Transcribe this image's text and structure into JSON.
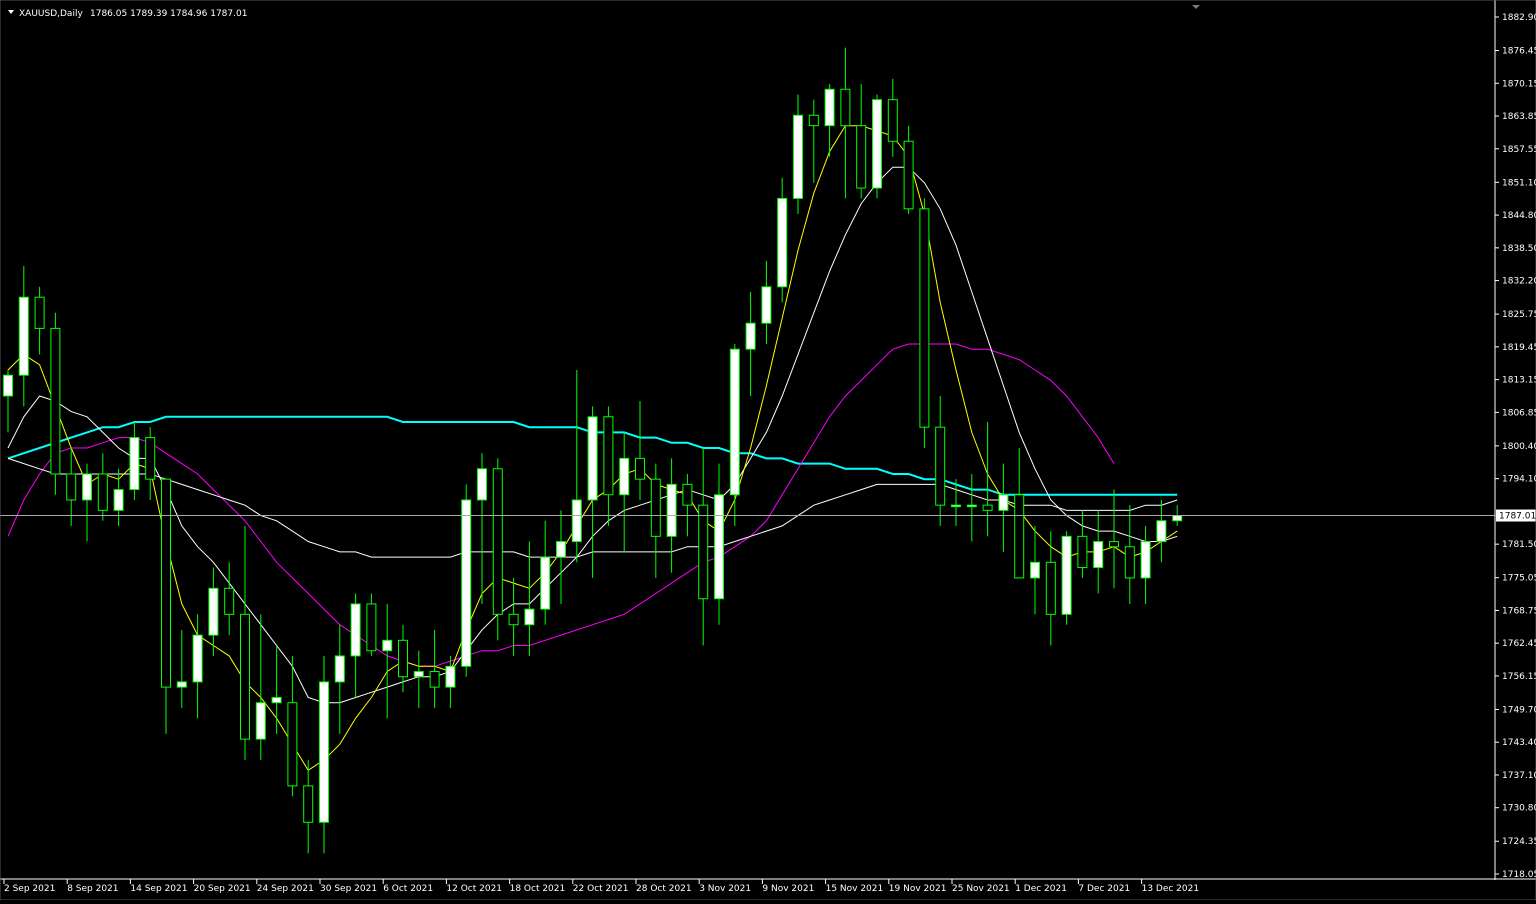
{
  "header": {
    "symbol": "XAUUSD,Daily",
    "ohlc": "1786.05 1789.39 1784.96 1787.01"
  },
  "colors": {
    "background": "#000000",
    "grid_line": "#ffffff",
    "bull_wick": "#00ff00",
    "bull_body": "#ffffff",
    "bear_wick": "#00ff00",
    "bear_body": "#000000",
    "ma_fast": "#ffff00",
    "ma_mid": "#ffffff",
    "ma_slow": "#ffffff",
    "ma_magenta": "#ff00ff",
    "ma_cyan": "#00ffff",
    "price_line": "#a9a9a9",
    "axis_text": "#ffffff"
  },
  "chart_data": {
    "type": "candlestick",
    "title": "XAUUSD,Daily",
    "ylim": [
      1718.05,
      1885.0
    ],
    "current_price": "1787.01",
    "y_ticks": [
      "1882.90",
      "1876.45",
      "1870.15",
      "1863.85",
      "1857.55",
      "1851.10",
      "1844.80",
      "1838.50",
      "1832.20",
      "1825.75",
      "1819.45",
      "1813.15",
      "1806.85",
      "1800.40",
      "1794.10",
      "1781.50",
      "1775.05",
      "1768.75",
      "1762.45",
      "1756.15",
      "1749.70",
      "1743.40",
      "1737.10",
      "1730.80",
      "1724.35",
      "1718.05"
    ],
    "x_ticks": [
      {
        "label": "2 Sep 2021",
        "index": 0
      },
      {
        "label": "8 Sep 2021",
        "index": 4
      },
      {
        "label": "14 Sep 2021",
        "index": 8
      },
      {
        "label": "20 Sep 2021",
        "index": 12
      },
      {
        "label": "24 Sep 2021",
        "index": 16
      },
      {
        "label": "30 Sep 2021",
        "index": 20
      },
      {
        "label": "6 Oct 2021",
        "index": 24
      },
      {
        "label": "12 Oct 2021",
        "index": 28
      },
      {
        "label": "18 Oct 2021",
        "index": 32
      },
      {
        "label": "22 Oct 2021",
        "index": 36
      },
      {
        "label": "28 Oct 2021",
        "index": 40
      },
      {
        "label": "3 Nov 2021",
        "index": 44
      },
      {
        "label": "9 Nov 2021",
        "index": 48
      },
      {
        "label": "15 Nov 2021",
        "index": 52
      },
      {
        "label": "19 Nov 2021",
        "index": 56
      },
      {
        "label": "25 Nov 2021",
        "index": 60
      },
      {
        "label": "1 Dec 2021",
        "index": 64
      },
      {
        "label": "7 Dec 2021",
        "index": 68
      },
      {
        "label": "13 Dec 2021",
        "index": 72
      }
    ],
    "candles": [
      [
        1810,
        1815,
        1803,
        1814
      ],
      [
        1814,
        1835,
        1808,
        1829
      ],
      [
        1829,
        1831,
        1818,
        1823
      ],
      [
        1823,
        1826,
        1791,
        1795
      ],
      [
        1795,
        1800,
        1785,
        1790
      ],
      [
        1790,
        1797,
        1782,
        1795
      ],
      [
        1795,
        1799,
        1786,
        1788
      ],
      [
        1788,
        1796,
        1785,
        1792
      ],
      [
        1792,
        1805,
        1790,
        1802
      ],
      [
        1802,
        1804,
        1790,
        1794
      ],
      [
        1794,
        1794,
        1745,
        1754
      ],
      [
        1754,
        1765,
        1750,
        1755
      ],
      [
        1755,
        1768,
        1748,
        1764
      ],
      [
        1764,
        1777,
        1760,
        1773
      ],
      [
        1773,
        1778,
        1764,
        1768
      ],
      [
        1768,
        1785,
        1740,
        1744
      ],
      [
        1744,
        1768,
        1740,
        1751
      ],
      [
        1751,
        1762,
        1745,
        1752
      ],
      [
        1751,
        1760,
        1733,
        1735
      ],
      [
        1735,
        1740,
        1722,
        1728
      ],
      [
        1728,
        1760,
        1722,
        1755
      ],
      [
        1755,
        1766,
        1745,
        1760
      ],
      [
        1760,
        1772,
        1752,
        1770
      ],
      [
        1770,
        1772,
        1760,
        1761
      ],
      [
        1761,
        1770,
        1748,
        1763
      ],
      [
        1763,
        1766,
        1753,
        1756
      ],
      [
        1756,
        1761,
        1750,
        1757
      ],
      [
        1757,
        1765,
        1750,
        1754
      ],
      [
        1754,
        1760,
        1750,
        1758
      ],
      [
        1758,
        1793,
        1756,
        1790
      ],
      [
        1790,
        1799,
        1770,
        1796
      ],
      [
        1796,
        1798,
        1763,
        1768
      ],
      [
        1768,
        1775,
        1760,
        1766
      ],
      [
        1766,
        1782,
        1760,
        1769
      ],
      [
        1769,
        1786,
        1766,
        1779
      ],
      [
        1779,
        1788,
        1770,
        1782
      ],
      [
        1782,
        1815,
        1778,
        1790
      ],
      [
        1790,
        1808,
        1775,
        1806
      ],
      [
        1806,
        1808,
        1785,
        1791
      ],
      [
        1791,
        1803,
        1780,
        1798
      ],
      [
        1798,
        1809,
        1790,
        1794
      ],
      [
        1794,
        1797,
        1775,
        1783
      ],
      [
        1783,
        1798,
        1776,
        1793
      ],
      [
        1793,
        1795,
        1783,
        1789
      ],
      [
        1789,
        1800,
        1762,
        1771
      ],
      [
        1771,
        1797,
        1766,
        1791
      ],
      [
        1791,
        1820,
        1785,
        1819
      ],
      [
        1819,
        1830,
        1810,
        1824
      ],
      [
        1824,
        1836,
        1820,
        1831
      ],
      [
        1831,
        1852,
        1828,
        1848
      ],
      [
        1848,
        1868,
        1845,
        1864
      ],
      [
        1864,
        1867,
        1851,
        1862
      ],
      [
        1862,
        1870,
        1856,
        1869
      ],
      [
        1869,
        1877,
        1848,
        1862
      ],
      [
        1862,
        1870,
        1848,
        1850
      ],
      [
        1850,
        1868,
        1848,
        1867
      ],
      [
        1867,
        1871,
        1856,
        1859
      ],
      [
        1859,
        1862,
        1845,
        1846
      ],
      [
        1846,
        1848,
        1800,
        1804
      ],
      [
        1804,
        1810,
        1785,
        1789
      ],
      [
        1789,
        1794,
        1785,
        1789
      ],
      [
        1789,
        1795,
        1782,
        1789
      ],
      [
        1789,
        1805,
        1783,
        1788
      ],
      [
        1788,
        1797,
        1780,
        1791
      ],
      [
        1791,
        1800,
        1778,
        1775
      ],
      [
        1775,
        1785,
        1768,
        1778
      ],
      [
        1778,
        1784,
        1762,
        1768
      ],
      [
        1768,
        1784,
        1766,
        1783
      ],
      [
        1783,
        1788,
        1775,
        1777
      ],
      [
        1777,
        1788,
        1772,
        1782
      ],
      [
        1782,
        1792,
        1773,
        1781
      ],
      [
        1781,
        1789,
        1770,
        1775
      ],
      [
        1775,
        1785,
        1770,
        1782
      ],
      [
        1782,
        1790,
        1778,
        1786
      ],
      [
        1786,
        1789,
        1785,
        1787
      ]
    ],
    "ma_fast": [
      1815,
      1818,
      1816,
      1808,
      1800,
      1793,
      1795,
      1794,
      1797,
      1796,
      1782,
      1770,
      1764,
      1762,
      1760,
      1755,
      1752,
      1748,
      1743,
      1738,
      1740,
      1743,
      1748,
      1752,
      1757,
      1759,
      1758,
      1758,
      1757,
      1765,
      1772,
      1775,
      1774,
      1773,
      1776,
      1780,
      1785,
      1790,
      1792,
      1795,
      1796,
      1793,
      1792,
      1791,
      1786,
      1784,
      1790,
      1800,
      1812,
      1825,
      1838,
      1849,
      1857,
      1862,
      1862,
      1861,
      1860,
      1856,
      1845,
      1828,
      1815,
      1803,
      1795,
      1790,
      1788,
      1784,
      1781,
      1779,
      1780,
      1780,
      1781,
      1779,
      1780,
      1782,
      1784
    ],
    "ma_mid": [
      1800,
      1806,
      1810,
      1809,
      1807,
      1806,
      1803,
      1800,
      1798,
      1798,
      1792,
      1785,
      1781,
      1778,
      1774,
      1770,
      1766,
      1762,
      1758,
      1752,
      1751,
      1751,
      1752,
      1753,
      1754,
      1755,
      1756,
      1756,
      1757,
      1761,
      1765,
      1768,
      1770,
      1770,
      1773,
      1776,
      1779,
      1783,
      1786,
      1788,
      1789,
      1790,
      1791,
      1792,
      1791,
      1790,
      1793,
      1798,
      1803,
      1810,
      1818,
      1826,
      1834,
      1841,
      1847,
      1851,
      1854,
      1854,
      1851,
      1846,
      1839,
      1830,
      1821,
      1812,
      1803,
      1796,
      1790,
      1787,
      1785,
      1784,
      1784,
      1783,
      1782,
      1782,
      1783
    ],
    "ma_slow": [
      1798,
      1797,
      1796,
      1795,
      1795,
      1795,
      1795,
      1795,
      1795,
      1795,
      1794,
      1793,
      1792,
      1791,
      1790,
      1789,
      1787,
      1786,
      1784,
      1782,
      1781,
      1780,
      1780,
      1779,
      1779,
      1779,
      1779,
      1779,
      1779,
      1780,
      1780,
      1780,
      1780,
      1779,
      1779,
      1779,
      1779,
      1780,
      1780,
      1780,
      1780,
      1780,
      1780,
      1781,
      1781,
      1781,
      1782,
      1783,
      1784,
      1785,
      1787,
      1789,
      1790,
      1791,
      1792,
      1793,
      1793,
      1793,
      1793,
      1793,
      1792,
      1791,
      1790,
      1790,
      1789,
      1789,
      1789,
      1788,
      1788,
      1788,
      1788,
      1788,
      1789,
      1789,
      1790
    ],
    "ma_magenta": [
      1783,
      1790,
      1795,
      1799,
      1800,
      1800,
      1801,
      1802,
      1802,
      1801,
      1799,
      1797,
      1795,
      1792,
      1789,
      1786,
      1782,
      1778,
      1775,
      1772,
      1769,
      1766,
      1764,
      1762,
      1760,
      1759,
      1758,
      1758,
      1759,
      1760,
      1761,
      1761,
      1762,
      1762,
      1763,
      1764,
      1765,
      1766,
      1767,
      1768,
      1770,
      1772,
      1774,
      1776,
      1778,
      1779,
      1781,
      1783,
      1786,
      1791,
      1796,
      1801,
      1806,
      1810,
      1813,
      1816,
      1819,
      1820,
      1820,
      1820,
      1820,
      1819,
      1819,
      1818,
      1817,
      1815,
      1813,
      1810,
      1806,
      1802,
      1797
    ],
    "ma_cyan": [
      1798,
      1799,
      1800,
      1801,
      1802,
      1803,
      1804,
      1804,
      1805,
      1805,
      1806,
      1806,
      1806,
      1806,
      1806,
      1806,
      1806,
      1806,
      1806,
      1806,
      1806,
      1806,
      1806,
      1806,
      1806,
      1805,
      1805,
      1805,
      1805,
      1805,
      1805,
      1805,
      1805,
      1804,
      1804,
      1804,
      1804,
      1803,
      1803,
      1803,
      1802,
      1802,
      1801,
      1801,
      1800,
      1800,
      1799,
      1799,
      1798,
      1798,
      1797,
      1797,
      1797,
      1796,
      1796,
      1796,
      1795,
      1795,
      1794,
      1794,
      1793,
      1792,
      1792,
      1791,
      1791,
      1791,
      1791,
      1791,
      1791,
      1791,
      1791,
      1791,
      1791,
      1791,
      1791
    ]
  }
}
